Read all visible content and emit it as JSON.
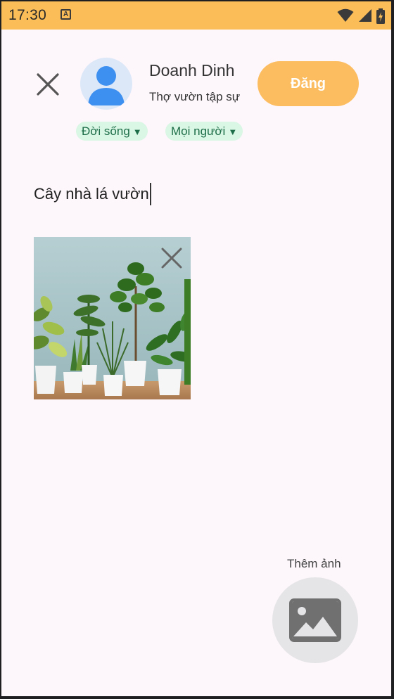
{
  "status_bar": {
    "time": "17:30",
    "notification_glyph": "A",
    "icons": [
      "wifi-icon",
      "signal-icon",
      "battery-charging-icon"
    ],
    "background": "#fbbd57"
  },
  "header": {
    "close_icon": "close-icon",
    "user_name": "Doanh Dinh",
    "user_role": "Thợ vườn tập sự",
    "post_label": "Đăng",
    "accent": "#fbbd60"
  },
  "chips": {
    "category": "Đời sống",
    "audience": "Mọi người",
    "arrow": "▼",
    "background": "#d9f7e4",
    "text_color": "#1f6e4a"
  },
  "composer": {
    "text": "Cây nhà lá vườn"
  },
  "attachment": {
    "image_subject": "potted houseplants",
    "remove_icon": "close-icon"
  },
  "add_photo": {
    "label": "Thêm ảnh",
    "icon": "image-icon"
  }
}
